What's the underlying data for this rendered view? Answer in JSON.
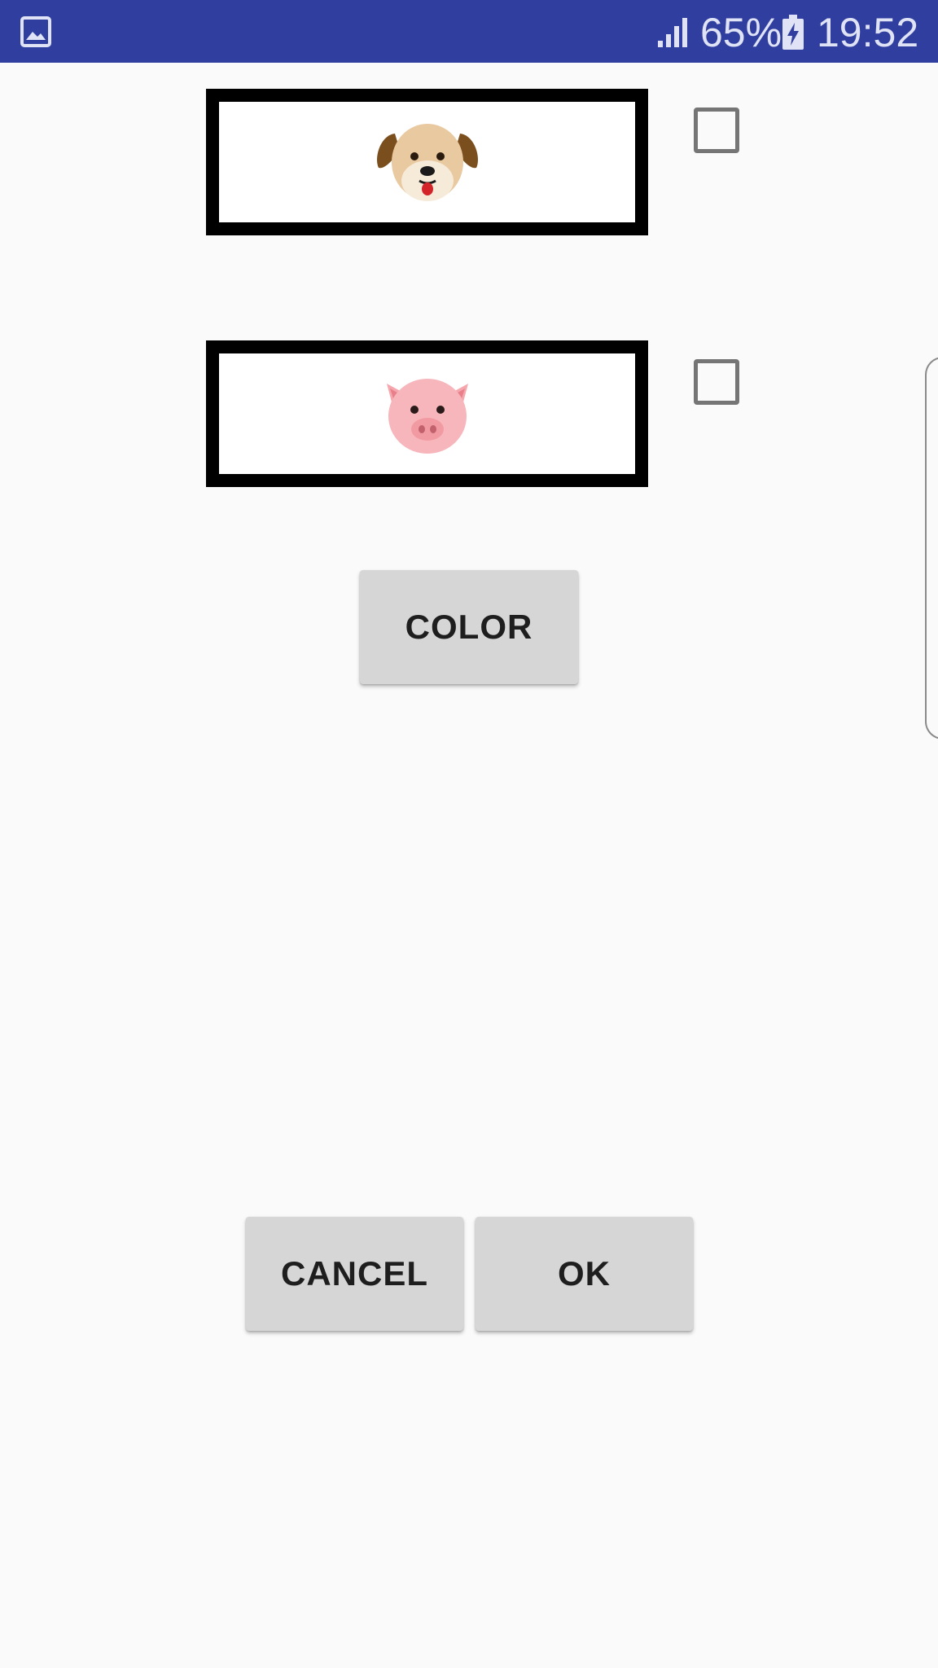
{
  "status_bar": {
    "battery_percent": "65%",
    "time": "19:52",
    "icons": [
      "gallery-icon",
      "signal-icon",
      "battery-charging-icon"
    ],
    "background_color": "#303f9f"
  },
  "options": [
    {
      "animal": "dog",
      "icon": "dog-face-icon",
      "checked": false
    },
    {
      "animal": "pig",
      "icon": "pig-face-icon",
      "checked": false
    }
  ],
  "buttons": {
    "color_label": "COLOR",
    "cancel_label": "CANCEL",
    "ok_label": "OK"
  }
}
